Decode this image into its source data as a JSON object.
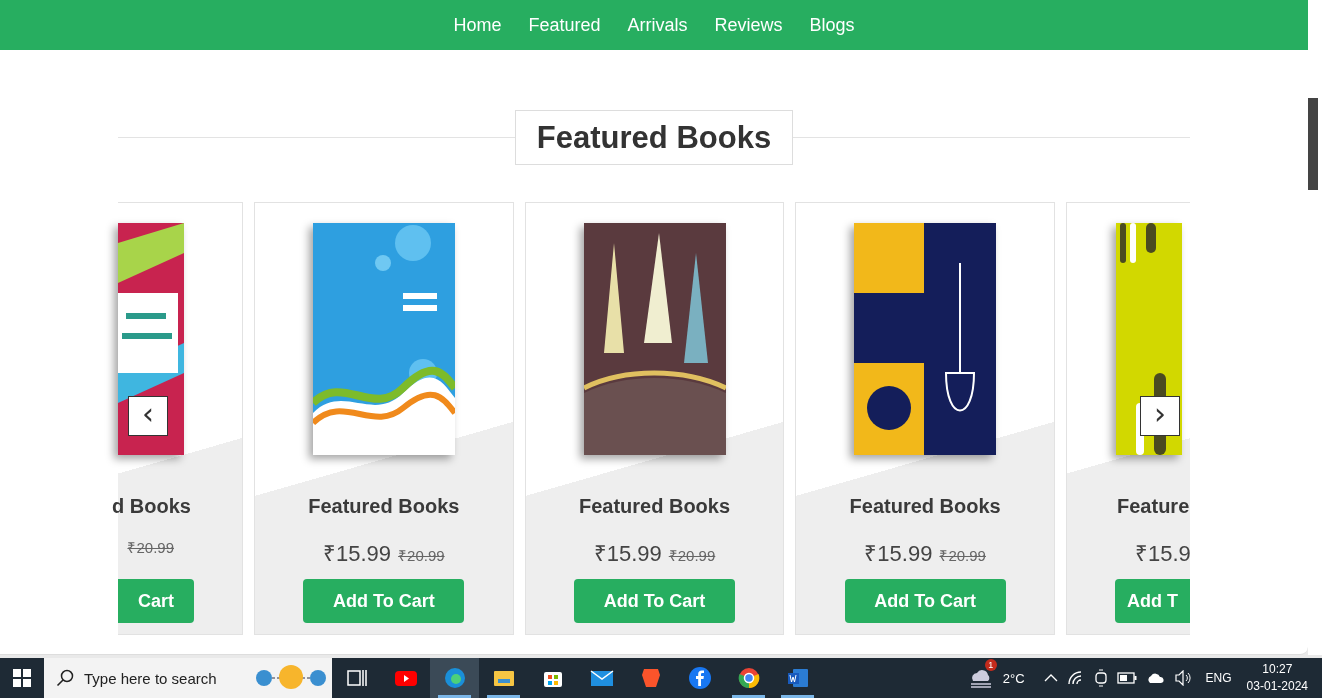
{
  "nav": {
    "items": [
      {
        "label": "Home"
      },
      {
        "label": "Featured"
      },
      {
        "label": "Arrivals"
      },
      {
        "label": "Reviews"
      },
      {
        "label": "Blogs"
      }
    ]
  },
  "section": {
    "title": "Featured Books"
  },
  "carousel": {
    "prev": "‹",
    "next": "›",
    "products": [
      {
        "kind": "partial-left",
        "title": "d Books",
        "old_price": "₹20.99",
        "button": "Cart"
      },
      {
        "kind": "full",
        "title": "Featured Books",
        "price": "₹15.99",
        "old_price": "₹20.99",
        "button": "Add To Cart"
      },
      {
        "kind": "full",
        "title": "Featured Books",
        "price": "₹15.99",
        "old_price": "₹20.99",
        "button": "Add To Cart"
      },
      {
        "kind": "full",
        "title": "Featured Books",
        "price": "₹15.99",
        "old_price": "₹20.99",
        "button": "Add To Cart"
      },
      {
        "kind": "partial-right",
        "title": "Feature",
        "price": "₹15.9",
        "button": "Add T"
      }
    ]
  },
  "taskbar": {
    "search": {
      "placeholder": "Type here to search"
    },
    "apps": [
      {
        "kind": "task-view",
        "selected": false,
        "running": false
      },
      {
        "kind": "youtube",
        "selected": false,
        "running": false
      },
      {
        "kind": "edge",
        "selected": true,
        "running": true
      },
      {
        "kind": "explorer",
        "selected": false,
        "running": true
      },
      {
        "kind": "store",
        "selected": false,
        "running": false
      },
      {
        "kind": "mail",
        "selected": false,
        "running": false
      },
      {
        "kind": "brave",
        "selected": false,
        "running": false
      },
      {
        "kind": "facebook",
        "selected": false,
        "running": false
      },
      {
        "kind": "chrome",
        "selected": false,
        "running": true
      },
      {
        "kind": "word",
        "selected": false,
        "running": true
      }
    ],
    "weather": {
      "badge": "1",
      "temperature": "2°C"
    },
    "language": "ENG",
    "time": "10:27",
    "date": "03-01-2024"
  }
}
